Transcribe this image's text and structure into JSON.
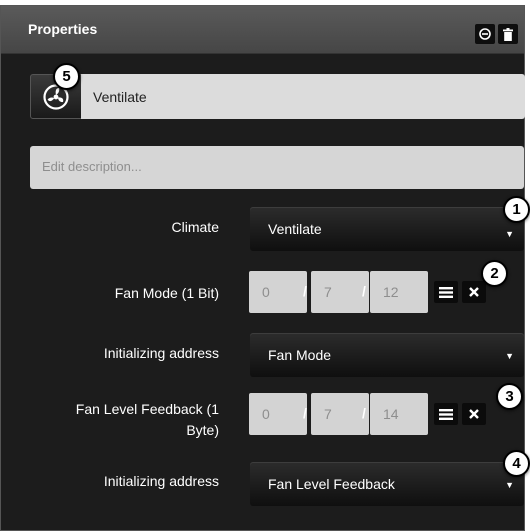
{
  "panel": {
    "title": "Properties",
    "header_buttons": [
      {
        "icon": "minus-circle-icon"
      },
      {
        "icon": "trash-icon"
      }
    ]
  },
  "object": {
    "icon": "fan-icon",
    "name": "Ventilate",
    "description_placeholder": "Edit description..."
  },
  "rows": {
    "climate": {
      "label": "Climate",
      "value": "Ventilate"
    },
    "fan_mode": {
      "label": "Fan Mode (1 Bit)",
      "address": [
        "0",
        "7",
        "12"
      ]
    },
    "init1": {
      "label": "Initializing address",
      "value": "Fan Mode"
    },
    "fan_level": {
      "label_line1": "Fan Level Feedback (1",
      "label_line2": "Byte)",
      "address": [
        "0",
        "7",
        "14"
      ]
    },
    "init2": {
      "label": "Initializing address",
      "value": "Fan Level Feedback"
    }
  },
  "separator": "/",
  "caret": "▼",
  "callouts": [
    "1",
    "2",
    "3",
    "4",
    "5"
  ],
  "colors": {
    "panel_bg": "#1c1c1c",
    "header_bg": "#4f4f4f",
    "field_bg": "#d3d3d3",
    "callout_bg": "#ffffff"
  }
}
